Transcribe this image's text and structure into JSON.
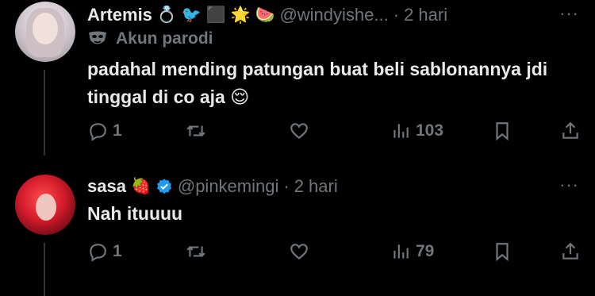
{
  "tweets": [
    {
      "author": "Artemis",
      "name_emojis": [
        "💍",
        "🐦",
        "⬛",
        "🌟",
        "🍉"
      ],
      "handle": "@windyishe...",
      "dot": "·",
      "time": "2 hari",
      "label": "Akun parodi",
      "text": "padahal mending patungan buat beli sablonannya jdi tinggal di co aja 😌",
      "reply_count": "1",
      "views": "103",
      "more": "···"
    },
    {
      "author": "sasa",
      "name_emojis": [
        "🍓"
      ],
      "handle": "@pinkemingi",
      "dot": "·",
      "time": "2 hari",
      "text": "Nah ituuuu",
      "reply_count": "1",
      "views": "79",
      "more": "···"
    }
  ],
  "colors": {
    "background": "#000000",
    "text": "#e7e9ea",
    "muted": "#71767b",
    "verified": "#1d9bf0"
  },
  "icons": [
    "reply-icon",
    "retweet-icon",
    "like-icon",
    "views-icon",
    "bookmark-icon",
    "share-icon",
    "more-icon",
    "verified-icon",
    "parody-mask-icon"
  ]
}
